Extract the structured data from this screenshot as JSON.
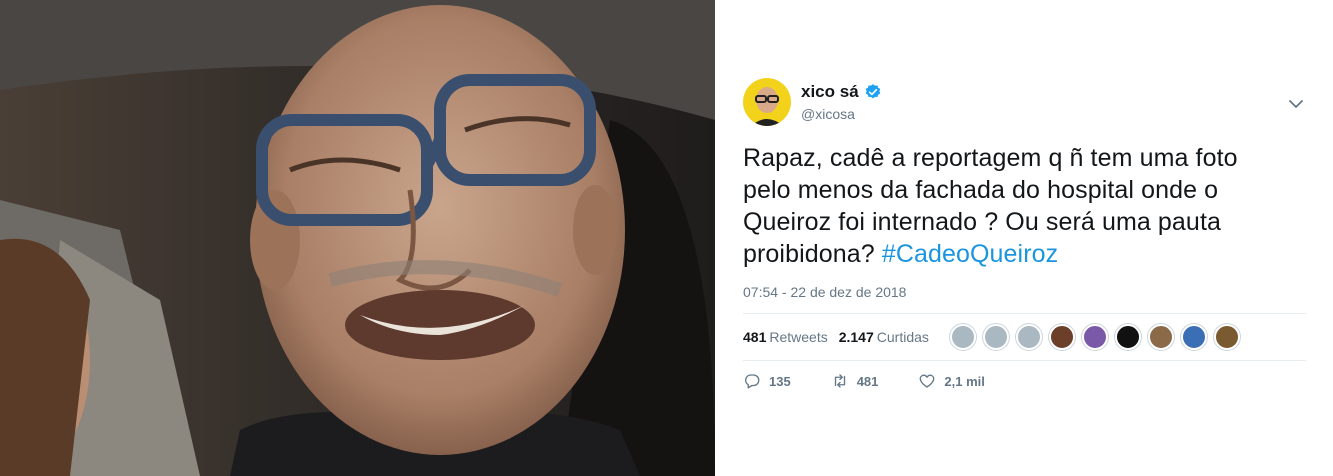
{
  "tweet": {
    "author_name": "xico sá",
    "author_handle": "@xicosa",
    "text_line1": "Rapaz, cadê a reportagem q ñ tem uma foto",
    "text_line2": "pelo menos da fachada do hospital onde o",
    "text_line3": "Queiroz foi internado ? Ou será uma pauta",
    "text_line4_plain": "proibidona? ",
    "hashtag": "#CadeoQueiroz",
    "timestamp": "07:54 - 22 de dez de 2018",
    "retweets_count": "481",
    "retweets_label": "Retweets",
    "likes_count": "2.147",
    "likes_label": "Curtidas",
    "reply_count": "135",
    "retweet_action_count": "481",
    "like_action_count": "2,1 mil"
  },
  "icons": {
    "verified": "verified-badge-icon",
    "caret": "chevron-down-icon",
    "reply": "reply-icon",
    "retweet": "retweet-icon",
    "like": "heart-icon"
  },
  "colors": {
    "link": "#1b95e0",
    "secondary_text": "#657786",
    "verified": "#1da1f2"
  },
  "liker_avatar_colors": [
    "#aab8c2",
    "#aab8c2",
    "#aab8c2",
    "#6b3f2a",
    "#7a5aa8",
    "#111111",
    "#8b6a4a",
    "#3b6fb5",
    "#7a5a30"
  ]
}
